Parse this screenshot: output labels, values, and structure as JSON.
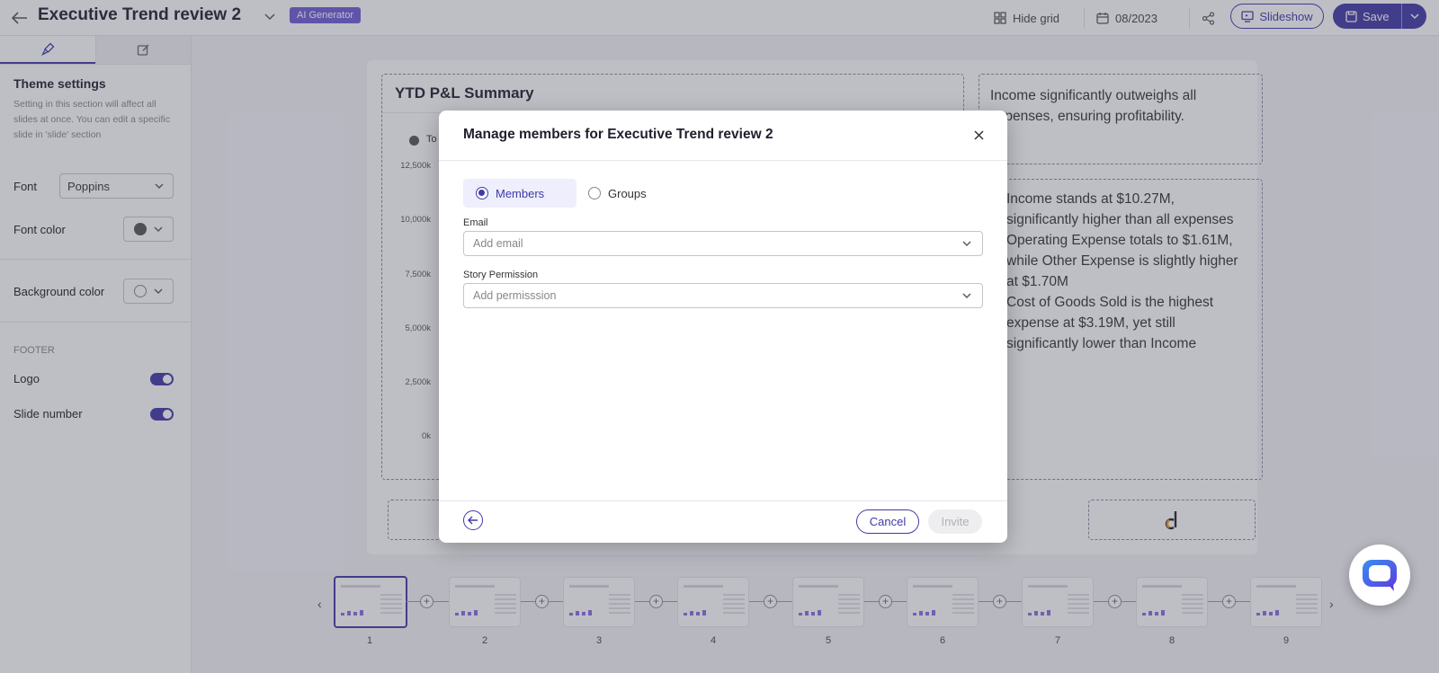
{
  "header": {
    "title": "Executive Trend review 2",
    "ai_badge": "AI Generator",
    "hide_grid": "Hide grid",
    "date": "08/2023",
    "slideshow": "Slideshow",
    "save": "Save"
  },
  "sidebar": {
    "heading": "Theme settings",
    "description": "Setting in this section will affect all slides at once. You can edit a specific slide in 'slide' section",
    "font_label": "Font",
    "font_value": "Poppins",
    "font_color_label": "Font color",
    "font_color": "#555555",
    "bg_color_label": "Background color",
    "footer_heading": "FOOTER",
    "logo_label": "Logo",
    "slide_number_label": "Slide number"
  },
  "slide": {
    "chart_title": "YTD P&L Summary",
    "legend_visible": "To",
    "y_ticks": [
      "12,500k",
      "10,000k",
      "7,500k",
      "5,000k",
      "2,500k",
      "0k"
    ],
    "note_top": "Income significantly outweighs all expenses, ensuring profitability.",
    "bullets": [
      "Income stands at $10.27M, significantly higher than all expenses",
      "Operating Expense totals to $1.61M, while Other Expense is slightly higher at $1.70M",
      "Cost of Goods Sold is the highest expense at $3.19M, yet still significantly lower than Income"
    ]
  },
  "thumbnails": {
    "numbers": [
      "1",
      "2",
      "3",
      "4",
      "5",
      "6",
      "7",
      "8",
      "9"
    ]
  },
  "modal": {
    "title": "Manage members for Executive Trend review 2",
    "members_label": "Members",
    "groups_label": "Groups",
    "email_label": "Email",
    "email_placeholder": "Add email",
    "permission_label": "Story Permission",
    "permission_placeholder": "Add permisssion",
    "cancel": "Cancel",
    "invite": "Invite"
  },
  "colors": {
    "accent": "#3f3aa6",
    "badge": "#6c5fd6"
  }
}
